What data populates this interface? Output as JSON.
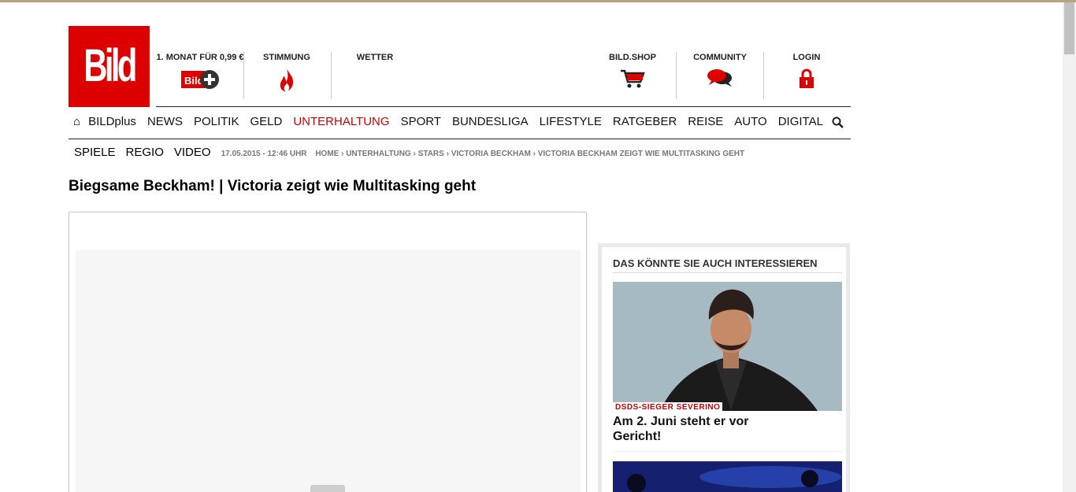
{
  "logo": "Bild",
  "header_services": {
    "bildplus_offer": "1. MONAT FÜR 0,99 €",
    "stimmung": "STIMMUNG",
    "wetter": "WETTER",
    "shop": "BILD.SHOP",
    "community": "COMMUNITY",
    "login": "LOGIN"
  },
  "main_nav": {
    "home_icon": "home-icon",
    "items": [
      "BILDplus",
      "NEWS",
      "POLITIK",
      "GELD",
      "UNTERHALTUNG",
      "SPORT",
      "BUNDESLIGA",
      "LIFESTYLE",
      "RATGEBER",
      "REISE",
      "AUTO",
      "DIGITAL"
    ],
    "active": "UNTERHALTUNG",
    "search_icon": "search-icon"
  },
  "sub_nav": {
    "items": [
      "SPIELE",
      "REGIO",
      "VIDEO"
    ],
    "timestamp": "17.05.2015 - 12:46 UHR",
    "breadcrumb": "HOME › UNTERHALTUNG › STARS › VICTORIA BECKHAM › VICTORIA BECKHAM ZEIGT WIE MULTITASKING GEHT"
  },
  "article": {
    "headline": "Biegsame Beckham! | Victoria zeigt wie Multitasking geht"
  },
  "sidebar": {
    "title": "DAS KÖNNTE SIE AUCH INTERESSIEREN",
    "teasers": [
      {
        "kicker": "DSDS-SIEGER SEVERINO",
        "title": "Am 2. Juni steht er vor Gericht!"
      }
    ]
  },
  "colors": {
    "brand_red": "#dd0000",
    "active_nav": "#cc0000"
  }
}
